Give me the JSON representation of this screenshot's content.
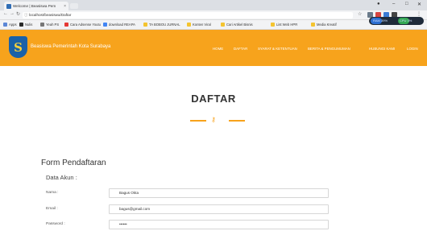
{
  "browser": {
    "tab_title": "Welcome | Beasiswa Pem",
    "tab_close": "×",
    "win_min": "–",
    "win_max": "□",
    "win_close": "✕",
    "url": "localhost/beasiswa/Daftar",
    "bookmarks": [
      {
        "label": "Apps",
        "color": "#5b86d6"
      },
      {
        "label": "Nulis",
        "color": "#2a2a2a"
      },
      {
        "label": "Yeah PS",
        "color": "#777777"
      },
      {
        "label": "Cara Adsense Youtu",
        "color": "#e53935"
      },
      {
        "label": "download REAPA",
        "color": "#4285f4"
      },
      {
        "label": "TA BOBOU JURNAL",
        "color": "#f4c430"
      },
      {
        "label": "Konten Viral",
        "color": "#f4c430"
      },
      {
        "label": "Cari Artikel Bisnis",
        "color": "#f4c430"
      },
      {
        "label": "List Web HPR",
        "color": "#f4c430"
      },
      {
        "label": "Media Kreatif",
        "color": "#f4c430"
      }
    ],
    "sys_ram": "RAM 39%",
    "sys_cpu": "CPU 3%"
  },
  "header": {
    "logo_glyph": "S",
    "brand": "Beasiswa Pemerintah Kota Surabaya",
    "nav": [
      "HOME",
      "DAFTAR",
      "SYARAT & KETENTUAN",
      "BERITA & PENGUMUMAN",
      "HUBUNGI KAMI",
      "LOGIN"
    ]
  },
  "page": {
    "title": "DAFTAR",
    "divider_icon": "key-icon"
  },
  "form": {
    "title": "Form Pendaftaran",
    "section": "Data Akun :",
    "fields": [
      {
        "label": "Nama :",
        "value": "Bagus Okta"
      },
      {
        "label": "Email :",
        "value": "bagus@gmail.com"
      },
      {
        "label": "Password :",
        "value": "••••••"
      }
    ]
  },
  "colors": {
    "accent": "#f7a31c",
    "logo_blue": "#1a61a8"
  }
}
